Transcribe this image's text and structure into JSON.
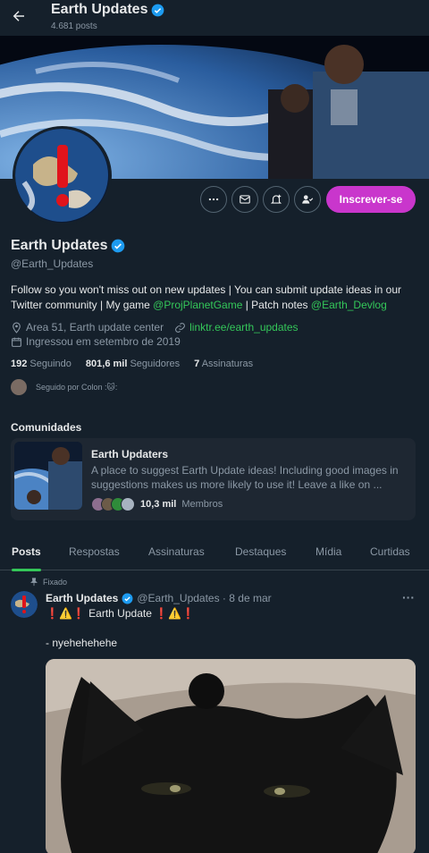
{
  "header": {
    "title": "Earth Updates",
    "posts_count": "4.681 posts"
  },
  "actions": {
    "subscribe_label": "Inscrever-se"
  },
  "profile": {
    "name": "Earth Updates",
    "handle": "@Earth_Updates",
    "bio_part1": "Follow so you won't miss out on new updates | You can submit update ideas in our Twitter community | My game ",
    "bio_link1": "@ProjPlanetGame",
    "bio_part2": " | Patch notes ",
    "bio_link2": "@Earth_Devlog",
    "location": "Area 51, Earth update center",
    "website": "linktr.ee/earth_updates",
    "joined": "Ingressou em setembro de 2019"
  },
  "stats": {
    "following_count": "192",
    "following_label": "Seguindo",
    "followers_count": "801,6 mil",
    "followers_label": "Seguidores",
    "subscriptions_count": "7",
    "subscriptions_label": "Assinaturas"
  },
  "followed_by": "Seguido por Colon :🐱:",
  "communities": {
    "heading": "Comunidades",
    "name": "Earth Updaters",
    "description": "A place to suggest Earth Update ideas! Including good images in suggestions makes us more likely to use it! Leave a like on ...",
    "members_count": "10,3 mil",
    "members_label": "Membros"
  },
  "tabs": [
    "Posts",
    "Respostas",
    "Assinaturas",
    "Destaques",
    "Mídia",
    "Curtidas"
  ],
  "post": {
    "pinned_label": "Fixado",
    "author": "Earth Updates",
    "handle_time": "@Earth_Updates · 8 de mar",
    "line1": "❗⚠️❗ Earth Update ❗⚠️❗",
    "line2": "- nyehehehehe"
  },
  "colors": {
    "background": "#15202b",
    "accent": "#34c759",
    "subscribe": "#c936cc",
    "verified": "#1d9bf0"
  },
  "icons": [
    "back-arrow-icon",
    "verified-icon",
    "more-icon",
    "message-icon",
    "notification-icon",
    "follow-icon",
    "location-icon",
    "link-icon",
    "calendar-icon",
    "pin-icon"
  ]
}
